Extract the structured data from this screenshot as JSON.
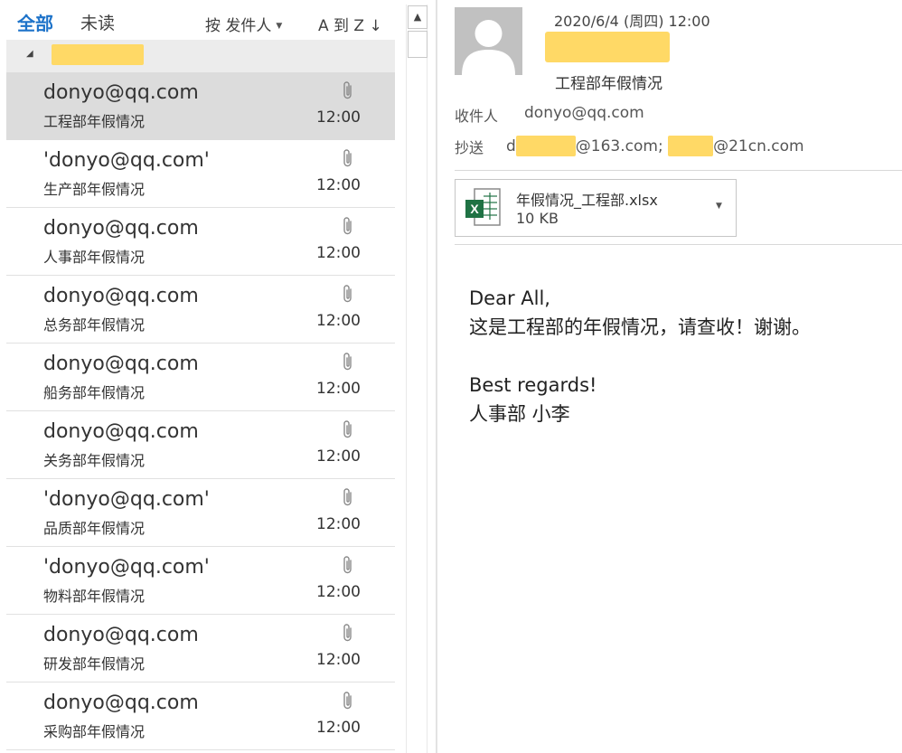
{
  "filters": {
    "all_label": "全部",
    "unread_label": "未读",
    "sort_by_label": "按 发件人",
    "sort_order_label": "A 到 Z ↓"
  },
  "messages": [
    {
      "sender": "donyo@qq.com",
      "subject": "工程部年假情况",
      "time": "12:00",
      "selected": true
    },
    {
      "sender": "'donyo@qq.com'",
      "subject": "生产部年假情况",
      "time": "12:00"
    },
    {
      "sender": "donyo@qq.com",
      "subject": "人事部年假情况",
      "time": "12:00"
    },
    {
      "sender": "donyo@qq.com",
      "subject": "总务部年假情况",
      "time": "12:00"
    },
    {
      "sender": "donyo@qq.com",
      "subject": "船务部年假情况",
      "time": "12:00"
    },
    {
      "sender": "donyo@qq.com",
      "subject": "关务部年假情况",
      "time": "12:00"
    },
    {
      "sender": "'donyo@qq.com'",
      "subject": "品质部年假情况",
      "time": "12:00"
    },
    {
      "sender": "'donyo@qq.com'",
      "subject": "物料部年假情况",
      "time": "12:00"
    },
    {
      "sender": "donyo@qq.com",
      "subject": "研发部年假情况",
      "time": "12:00"
    },
    {
      "sender": "donyo@qq.com",
      "subject": "采购部年假情况",
      "time": "12:00"
    }
  ],
  "reading": {
    "date": "2020/6/4 (周四) 12:00",
    "subject": "工程部年假情况",
    "to_label": "收件人",
    "to_value": "donyo@qq.com",
    "cc_label": "抄送",
    "cc_part1": "d",
    "cc_part2": "@163.com;",
    "cc_part3": "@21cn.com",
    "attachment": {
      "name": "年假情况_工程部.xlsx",
      "size": "10 KB"
    },
    "body": {
      "greeting": "Dear All,",
      "line1": "这是工程部的年假情况，请查收！谢谢。",
      "closing": "Best regards!",
      "signature": "人事部 小李"
    }
  },
  "colors": {
    "accent": "#1e73c9",
    "redaction": "#ffd966",
    "selected_row": "#dcdcdc",
    "excel_green": "#1f7244"
  },
  "icons": [
    "paperclip-icon",
    "person-avatar-icon",
    "excel-file-icon",
    "collapse-arrow-icon",
    "scroll-up-icon",
    "dropdown-caret-icon"
  ]
}
